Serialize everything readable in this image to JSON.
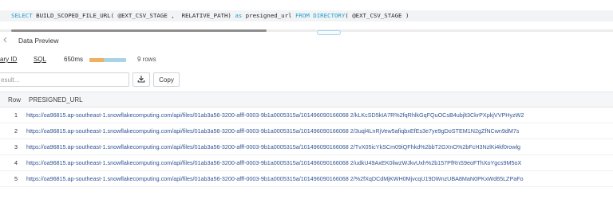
{
  "sql": {
    "kw_select": "SELECT",
    "fn_text": " BUILD_SCOPED_FILE_URL( @EXT_CSV_STAGE ,  RELATIVE_PATH) ",
    "kw_as": "as",
    "alias": " presigned_url ",
    "kw_from": "FROM",
    "kw_directory": " DIRECTORY",
    "dir_arg": "( @EXT_CSV_STAGE )"
  },
  "tabs": {
    "data_preview_label": "Data Preview"
  },
  "query_info": {
    "query_id_link": "ary ID",
    "sql_link": "SQL",
    "duration": "650ms",
    "rows": "9 rows",
    "timing_fraction": 0.4,
    "colors": {
      "segment": "#f0b060",
      "bar": "#a8d4e6"
    }
  },
  "filter": {
    "placeholder": "esult..."
  },
  "actions": {
    "download_icon": "download-icon",
    "copy_label": "Copy"
  },
  "grid": {
    "columns": [
      "Row",
      "PRESIGNED_URL"
    ],
    "rows": [
      {
        "row": "1",
        "url": "https://oa96815.ap-southeast-1.snowflakecomputing.com/api/files/01ab3a56-3200-afff-0003-9b1a0005315a/101496090166068 2/kLKcSD5kIA7R%2fqRhlkGqFQuOCsB4ubjlt3CkrPXpkjVVPHyzW2"
      },
      {
        "row": "2",
        "url": "https://oa96815.ap-southeast-1.snowflakecomputing.com/api/files/01ab3a56-3200-afff-0003-9b1a0005315a/101496090166068 2/3uql4LnRjVew5afiqbxEfEs3e7ye9gDoSTEM1N2gZfNCwn9dM7s"
      },
      {
        "row": "3",
        "url": "https://oa96815.ap-southeast-1.snowflakecomputing.com/api/files/01ab3a56-3200-afff-0003-9b1a0005315a/101496090166068 2/TvX05icYkSCm09iQFhkd%2bbT2GXnO%2bFcH3NzlKi4kf0rowlg"
      },
      {
        "row": "4",
        "url": "https://oa96815.ap-southeast-1.snowflakecomputing.com/api/files/01ab3a56-3200-afff-0003-9b1a0005315a/101496090166068 2/udkU49AxEK0liwzWJkvUxh%2b157PfRnS9eoFThXoYgcs9M5oX"
      },
      {
        "row": "5",
        "url": "https://oa96815.ap-southeast-1.snowflakecomputing.com/api/files/01ab3a56-3200-afff-0003-9b1a0005315a/101496090166068 2/%2fXqDCdMjKWH0MjvcqU19DWnzUBA8MaN0PKxWd65LZPaFo"
      }
    ]
  }
}
